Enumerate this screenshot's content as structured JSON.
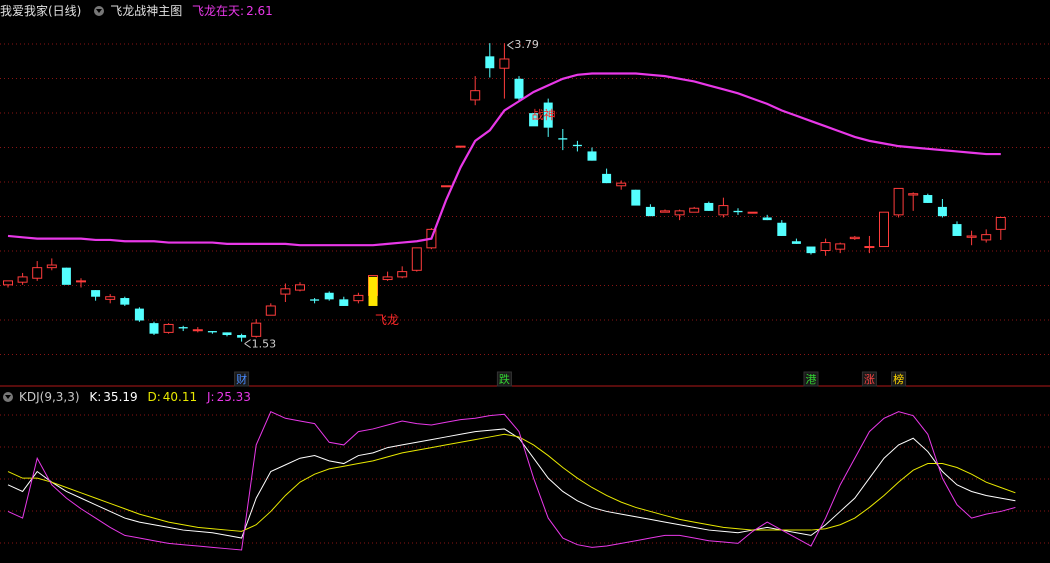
{
  "header": {
    "symbol": "我爱我家(日线)",
    "indicator_name": "飞龙战神主图",
    "feilong_label": "飞龙在天:",
    "feilong_value": "2.61"
  },
  "kdj_header": {
    "name": "KDJ(9,3,3)",
    "k_label": "K:",
    "k_value": "35.19",
    "d_label": "D:",
    "d_value": "40.11",
    "j_label": "J:",
    "j_value": "25.33"
  },
  "colors": {
    "background": "#000000",
    "up": "#ff3c3c",
    "down": "#54ffff",
    "ma_line": "#e838e8",
    "grid": "#8a1515",
    "signal": "#ffe600",
    "k_line": "#ffffff",
    "d_line": "#e8e800",
    "j_line": "#e838e8"
  },
  "annotations": {
    "high_label": "3.79",
    "low_label": "1.53",
    "feilong_mark": "飞龙",
    "zhanshen_mark": "战神"
  },
  "event_tags": [
    {
      "text": "财",
      "color": "#4a8cff",
      "index": 16
    },
    {
      "text": "跌",
      "color": "#32d232",
      "index": 34
    },
    {
      "text": "港",
      "color": "#32d232",
      "index": 55
    },
    {
      "text": "涨",
      "color": "#ff4444",
      "index": 59
    },
    {
      "text": "榜",
      "color": "#ffd700",
      "index": 61
    }
  ],
  "chart_data": [
    {
      "type": "candlestick",
      "title": "飞龙战神主图",
      "ylim": [
        1.3,
        3.95
      ],
      "candles": [
        [
          1.96,
          1.99,
          1.94,
          1.99
        ],
        [
          1.98,
          2.05,
          1.96,
          2.02
        ],
        [
          2.01,
          2.14,
          1.99,
          2.09
        ],
        [
          2.09,
          2.16,
          2.07,
          2.11
        ],
        [
          2.09,
          2.09,
          1.98,
          1.96
        ],
        [
          1.99,
          2.01,
          1.94,
          1.99
        ],
        [
          1.92,
          1.92,
          1.84,
          1.87
        ],
        [
          1.85,
          1.89,
          1.82,
          1.87
        ],
        [
          1.86,
          1.87,
          1.8,
          1.81
        ],
        [
          1.78,
          1.79,
          1.68,
          1.69
        ],
        [
          1.67,
          1.68,
          1.58,
          1.59
        ],
        [
          1.6,
          1.67,
          1.59,
          1.66
        ],
        [
          1.64,
          1.65,
          1.61,
          1.63
        ],
        [
          1.62,
          1.64,
          1.6,
          1.62
        ],
        [
          1.61,
          1.61,
          1.59,
          1.6
        ],
        [
          1.6,
          1.6,
          1.57,
          1.58
        ],
        [
          1.58,
          1.59,
          1.53,
          1.56
        ],
        [
          1.57,
          1.7,
          1.56,
          1.67
        ],
        [
          1.73,
          1.82,
          1.73,
          1.8
        ],
        [
          1.89,
          1.97,
          1.83,
          1.93
        ],
        [
          1.92,
          1.98,
          1.91,
          1.96
        ],
        [
          1.85,
          1.86,
          1.82,
          1.84
        ],
        [
          1.9,
          1.91,
          1.84,
          1.85
        ],
        [
          1.85,
          1.87,
          1.8,
          1.8
        ],
        [
          1.84,
          1.9,
          1.82,
          1.88
        ],
        [
          1.88,
          2.03,
          1.87,
          2.03
        ],
        [
          2.0,
          2.06,
          1.99,
          2.02
        ],
        [
          2.02,
          2.1,
          2.01,
          2.06
        ],
        [
          2.07,
          2.24,
          2.06,
          2.24
        ],
        [
          2.24,
          2.39,
          2.23,
          2.38
        ],
        [
          2.71,
          2.71,
          2.71,
          2.71
        ],
        [
          3.01,
          3.01,
          3.01,
          3.01
        ],
        [
          3.36,
          3.54,
          3.32,
          3.43
        ],
        [
          3.69,
          3.79,
          3.53,
          3.6
        ],
        [
          3.6,
          3.79,
          3.37,
          3.67
        ],
        [
          3.52,
          3.54,
          3.35,
          3.37
        ],
        [
          3.26,
          3.26,
          3.22,
          3.16
        ],
        [
          3.34,
          3.37,
          3.08,
          3.15
        ],
        [
          3.07,
          3.14,
          2.98,
          3.06
        ],
        [
          3.02,
          3.05,
          2.97,
          3.01
        ],
        [
          2.97,
          3.0,
          2.9,
          2.9
        ],
        [
          2.8,
          2.84,
          2.73,
          2.73
        ],
        [
          2.71,
          2.75,
          2.68,
          2.73
        ],
        [
          2.68,
          2.68,
          2.57,
          2.56
        ],
        [
          2.55,
          2.57,
          2.48,
          2.48
        ],
        [
          2.51,
          2.53,
          2.51,
          2.52
        ],
        [
          2.49,
          2.53,
          2.45,
          2.52
        ],
        [
          2.51,
          2.55,
          2.51,
          2.54
        ],
        [
          2.58,
          2.59,
          2.52,
          2.52
        ],
        [
          2.49,
          2.62,
          2.47,
          2.56
        ],
        [
          2.52,
          2.54,
          2.49,
          2.51
        ],
        [
          2.51,
          2.51,
          2.51,
          2.51
        ],
        [
          2.47,
          2.49,
          2.45,
          2.45
        ],
        [
          2.43,
          2.45,
          2.33,
          2.33
        ],
        [
          2.29,
          2.31,
          2.27,
          2.27
        ],
        [
          2.25,
          2.24,
          2.19,
          2.2
        ],
        [
          2.22,
          2.31,
          2.18,
          2.28
        ],
        [
          2.23,
          2.28,
          2.2,
          2.27
        ],
        [
          2.31,
          2.33,
          2.3,
          2.32
        ],
        [
          2.25,
          2.33,
          2.2,
          2.25
        ],
        [
          2.25,
          2.51,
          2.25,
          2.51
        ],
        [
          2.49,
          2.69,
          2.47,
          2.69
        ],
        [
          2.64,
          2.66,
          2.52,
          2.65
        ],
        [
          2.64,
          2.65,
          2.58,
          2.58
        ],
        [
          2.55,
          2.61,
          2.47,
          2.48
        ],
        [
          2.42,
          2.44,
          2.33,
          2.33
        ],
        [
          2.32,
          2.37,
          2.26,
          2.33
        ],
        [
          2.3,
          2.38,
          2.28,
          2.34
        ],
        [
          2.38,
          2.41,
          2.3,
          2.47
        ]
      ],
      "ma_line": [
        2.33,
        2.32,
        2.31,
        2.31,
        2.31,
        2.31,
        2.3,
        2.3,
        2.29,
        2.29,
        2.29,
        2.28,
        2.28,
        2.28,
        2.28,
        2.27,
        2.27,
        2.27,
        2.27,
        2.27,
        2.26,
        2.26,
        2.26,
        2.26,
        2.26,
        2.26,
        2.27,
        2.28,
        2.29,
        2.31,
        2.6,
        2.85,
        3.05,
        3.13,
        3.28,
        3.35,
        3.42,
        3.47,
        3.52,
        3.55,
        3.56,
        3.56,
        3.56,
        3.56,
        3.55,
        3.54,
        3.52,
        3.5,
        3.47,
        3.44,
        3.41,
        3.37,
        3.33,
        3.28,
        3.24,
        3.2,
        3.16,
        3.12,
        3.08,
        3.05,
        3.03,
        3.01,
        3.0,
        2.99,
        2.98,
        2.97,
        2.96,
        2.95,
        2.95
      ]
    },
    {
      "type": "line",
      "title": "KDJ(9,3,3)",
      "ylim": [
        -5,
        110
      ],
      "series": [
        {
          "name": "K",
          "values": [
            50,
            45,
            60,
            52,
            45,
            40,
            35,
            30,
            25,
            22,
            20,
            18,
            16,
            15,
            14,
            12,
            10,
            40,
            60,
            65,
            70,
            72,
            68,
            66,
            72,
            74,
            78,
            80,
            82,
            84,
            86,
            88,
            90,
            91,
            92,
            85,
            70,
            55,
            45,
            38,
            33,
            30,
            28,
            26,
            24,
            22,
            20,
            18,
            16,
            15,
            14,
            16,
            18,
            16,
            14,
            12,
            20,
            30,
            40,
            55,
            70,
            80,
            85,
            75,
            60,
            50,
            45,
            42,
            40,
            38
          ]
        },
        {
          "name": "D",
          "values": [
            60,
            55,
            55,
            52,
            48,
            44,
            40,
            36,
            32,
            28,
            25,
            22,
            20,
            18,
            17,
            16,
            15,
            20,
            30,
            42,
            52,
            58,
            62,
            64,
            66,
            68,
            71,
            74,
            76,
            78,
            80,
            82,
            84,
            86,
            88,
            86,
            80,
            72,
            63,
            55,
            48,
            42,
            37,
            33,
            30,
            27,
            24,
            22,
            20,
            18,
            17,
            16,
            16,
            16,
            16,
            16,
            17,
            20,
            25,
            33,
            42,
            52,
            61,
            66,
            66,
            63,
            58,
            52,
            48,
            44
          ]
        },
        {
          "name": "J",
          "values": [
            30,
            25,
            70,
            50,
            40,
            32,
            25,
            18,
            12,
            10,
            8,
            6,
            5,
            4,
            3,
            2,
            1,
            80,
            105,
            100,
            98,
            96,
            82,
            80,
            90,
            92,
            95,
            98,
            96,
            95,
            97,
            99,
            100,
            102,
            103,
            90,
            55,
            25,
            10,
            5,
            3,
            4,
            6,
            8,
            10,
            12,
            12,
            10,
            8,
            7,
            6,
            15,
            22,
            16,
            10,
            4,
            25,
            50,
            70,
            90,
            100,
            105,
            102,
            88,
            55,
            35,
            25,
            28,
            30,
            33
          ]
        }
      ]
    }
  ]
}
